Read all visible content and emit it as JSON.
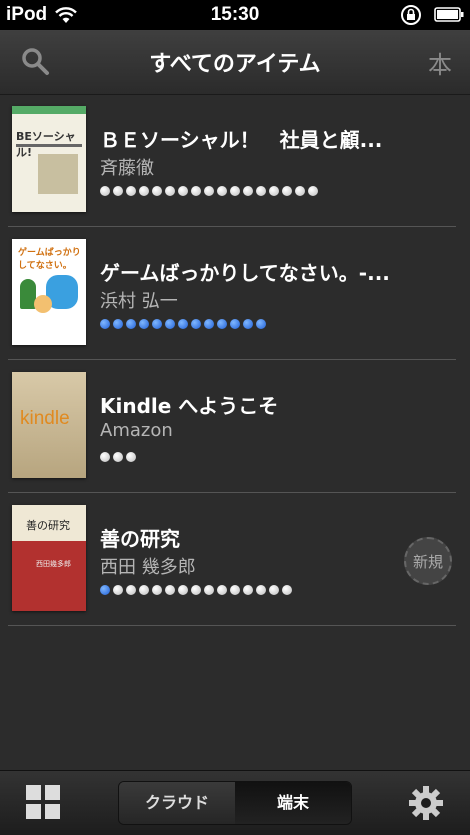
{
  "status_bar": {
    "carrier": "iPod",
    "time": "15:30"
  },
  "header": {
    "title": "すべてのアイテム",
    "right_icon_label": "本"
  },
  "items": [
    {
      "title": "ＢＥソーシャル！　社員と顧...",
      "author": "斉藤徹",
      "progress_dots_total": 17,
      "progress_dots_read": 0,
      "cover_text": "BEソーシャル!",
      "new_badge": ""
    },
    {
      "title": "ゲームばっかりしてなさい。-...",
      "author": "浜村 弘一",
      "progress_dots_total": 13,
      "progress_dots_read": 13,
      "cover_text": "ゲームばっかりしてなさい。",
      "new_badge": ""
    },
    {
      "title": "Kindle へようこそ",
      "author": "Amazon",
      "progress_dots_total": 3,
      "progress_dots_read": 0,
      "cover_text": "kindle",
      "new_badge": ""
    },
    {
      "title": "善の研究",
      "author": "西田 幾多郎",
      "progress_dots_total": 15,
      "progress_dots_read": 1,
      "cover_text": "善の研究",
      "cover_author": "西田幾多郎",
      "new_badge": "新規"
    }
  ],
  "bottom_bar": {
    "cloud_label": "クラウド",
    "device_label": "端末",
    "selected": "端末"
  },
  "colors": {
    "background": "#2c2c2c",
    "progress_blue": "#1f5fd6",
    "text_secondary": "#b5b5b5"
  }
}
